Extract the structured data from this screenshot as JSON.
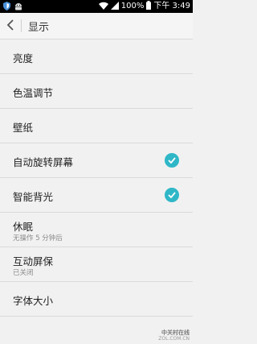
{
  "status_bar": {
    "battery_percent": "100%",
    "time": "下午 3:49",
    "icons": [
      "shield-icon",
      "android-icon",
      "wifi-icon",
      "signal-icon",
      "battery-icon"
    ]
  },
  "action_bar": {
    "title": "显示",
    "back_icon": "chevron-left-icon"
  },
  "settings": [
    {
      "title": "亮度"
    },
    {
      "title": "色温调节"
    },
    {
      "title": "壁纸"
    },
    {
      "title": "自动旋转屏幕",
      "checked": true
    },
    {
      "title": "智能背光",
      "checked": true
    },
    {
      "title": "休眠",
      "subtitle": "无操作 5 分钟后"
    },
    {
      "title": "互动屏保",
      "subtitle": "已关闭"
    },
    {
      "title": "字体大小"
    }
  ],
  "watermark": {
    "line1": "中关村在线",
    "line2": "ZOL.COM.CN"
  },
  "colors": {
    "accent": "#2fb7c7",
    "background": "#f1f1f1",
    "status_bar": "#000000"
  }
}
